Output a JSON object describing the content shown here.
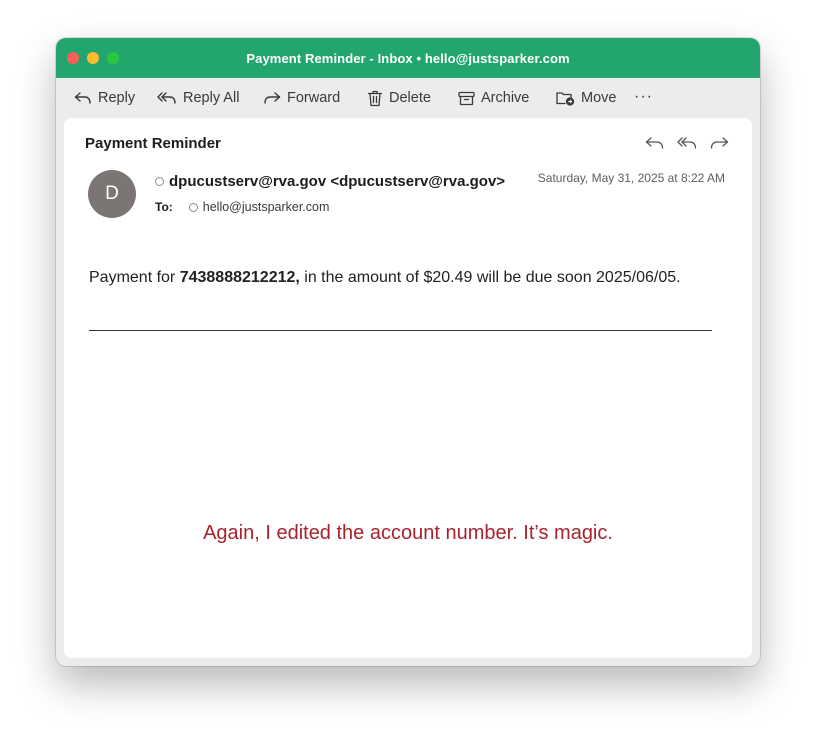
{
  "window": {
    "title": "Payment Reminder - Inbox • hello@justsparker.com"
  },
  "toolbar": {
    "reply": "Reply",
    "reply_all": "Reply All",
    "forward": "Forward",
    "delete": "Delete",
    "archive": "Archive",
    "move": "Move",
    "more": "···"
  },
  "message": {
    "subject": "Payment Reminder",
    "avatar_initial": "D",
    "from": "dpucustserv@rva.gov <dpucustserv@rva.gov>",
    "to_label": "To:",
    "to": "hello@justsparker.com",
    "date": "Saturday, May 31, 2025 at 8:22 AM",
    "body_prefix": "Payment for ",
    "account_number": "7438888212212,",
    "body_suffix": " in the amount of $20.49 will be due soon 2025/06/05."
  },
  "annotation": {
    "text": "Again, I edited the account number. It’s magic."
  },
  "colors": {
    "titlebar": "#23a56e",
    "annotation": "#a8232c",
    "avatar": "#7b7573"
  }
}
